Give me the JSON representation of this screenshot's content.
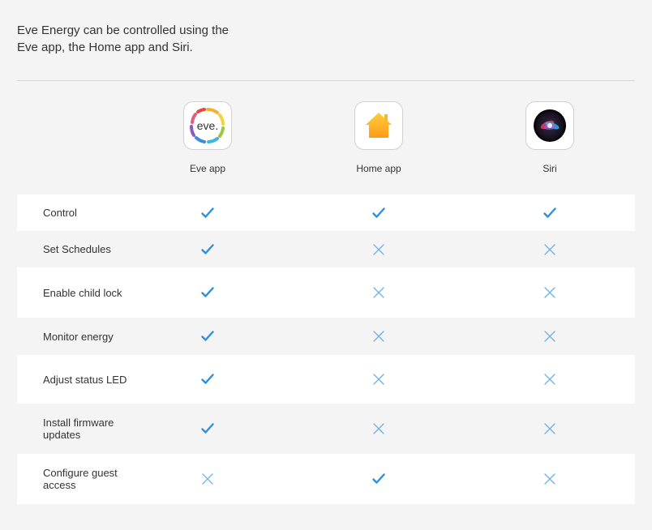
{
  "intro": {
    "text_line1": "Eve Energy can be controlled using the",
    "text_line2": "Eve app, the Home app and Siri."
  },
  "apps": [
    {
      "label": "Eve app",
      "icon": "eve-app-icon",
      "icon_text": "eve."
    },
    {
      "label": "Home app",
      "icon": "home-app-icon"
    },
    {
      "label": "Siri",
      "icon": "siri-icon"
    }
  ],
  "colors": {
    "check": "#2f8fd8",
    "cross": "#6fb3e6",
    "row_white": "#ffffff",
    "background": "#f4f4f4"
  },
  "features": [
    {
      "label": "Control",
      "values": [
        true,
        true,
        true
      ]
    },
    {
      "label": "Set Schedules",
      "values": [
        true,
        false,
        false
      ]
    },
    {
      "label": "Enable child lock",
      "values": [
        true,
        false,
        false
      ]
    },
    {
      "label": "Monitor energy",
      "values": [
        true,
        false,
        false
      ]
    },
    {
      "label": "Adjust status LED",
      "values": [
        true,
        false,
        false
      ]
    },
    {
      "label": "Install firmware updates",
      "values": [
        true,
        false,
        false
      ]
    },
    {
      "label": "Configure guest access",
      "values": [
        false,
        true,
        false
      ]
    }
  ]
}
